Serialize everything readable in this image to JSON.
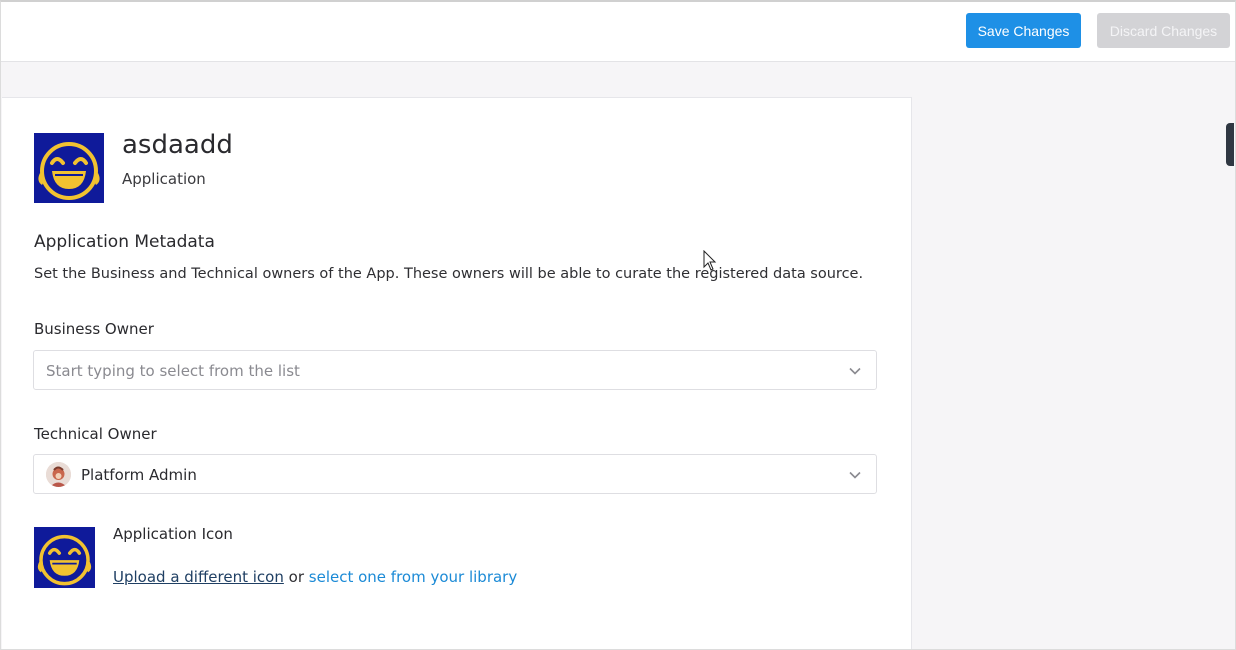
{
  "toolbar": {
    "save_label": "Save Changes",
    "discard_label": "Discard Changes"
  },
  "app": {
    "name": "asdaadd",
    "type": "Application",
    "icon": "laughing-emoji-icon"
  },
  "metadata": {
    "title": "Application Metadata",
    "description": "Set the Business and Technical owners of the App. These owners will be able to curate the registered data source."
  },
  "business_owner": {
    "label": "Business Owner",
    "placeholder": "Start typing to select from the list"
  },
  "technical_owner": {
    "label": "Technical Owner",
    "value": "Platform Admin"
  },
  "application_icon": {
    "label": "Application Icon",
    "upload_link": "Upload a different icon",
    "or_text": "or",
    "library_link": "select one from your library"
  },
  "colors": {
    "primary": "#1e90e6",
    "icon_bg": "#0f1a9a",
    "icon_fg": "#f2c230",
    "link": "#1b8ad6"
  }
}
